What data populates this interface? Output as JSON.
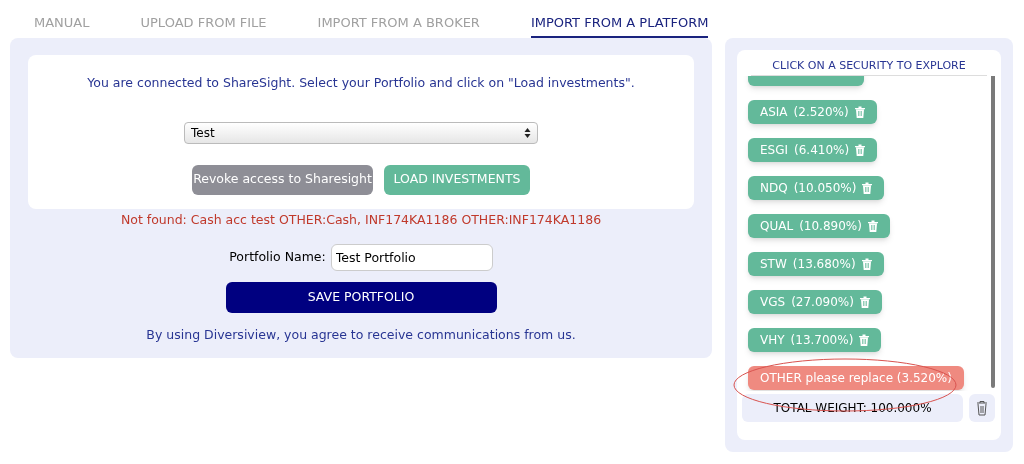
{
  "tabs": [
    {
      "label": "MANUAL",
      "selected": false
    },
    {
      "label": "UPLOAD FROM FILE",
      "selected": false
    },
    {
      "label": "IMPORT FROM A BROKER",
      "selected": false
    },
    {
      "label": "IMPORT FROM A PLATFORM",
      "selected": true
    }
  ],
  "connect_card": {
    "message": "You are connected to ShareSight. Select your Portfolio and click on \"Load investments\".",
    "portfolio_select": {
      "value": "Test"
    },
    "buttons": [
      {
        "label": "Revoke access to Sharesight",
        "kind": "secondary"
      },
      {
        "label": "LOAD INVESTMENTS",
        "kind": "primary"
      }
    ]
  },
  "error": "Not found: Cash acc test OTHER:Cash, INF174KA1186 OTHER:INF174KA1186",
  "portfolio_name": {
    "label": "Portfolio Name:",
    "value": "Test Portfolio"
  },
  "save_button": "SAVE PORTFOLIO",
  "footer_note": "By using Diversiview, you agree to receive communications from us.",
  "securities": {
    "heading": "CLICK ON A SECURITY TO EXPLORE",
    "items": [
      {
        "kind": "cut"
      },
      {
        "kind": "security",
        "ticker": "ASIA",
        "weight": "(2.520%)"
      },
      {
        "kind": "security",
        "ticker": "ESGI",
        "weight": "(6.410%)"
      },
      {
        "kind": "security",
        "ticker": "NDQ",
        "weight": "(10.050%)"
      },
      {
        "kind": "security",
        "ticker": "QUAL",
        "weight": "(10.890%)"
      },
      {
        "kind": "security",
        "ticker": "STW",
        "weight": "(13.680%)"
      },
      {
        "kind": "security",
        "ticker": "VGS",
        "weight": "(27.090%)"
      },
      {
        "kind": "security",
        "ticker": "VHY",
        "weight": "(13.700%)"
      },
      {
        "kind": "other",
        "label": "OTHER please replace (3.520%)"
      }
    ],
    "total": "TOTAL WEIGHT: 100.000%"
  }
}
